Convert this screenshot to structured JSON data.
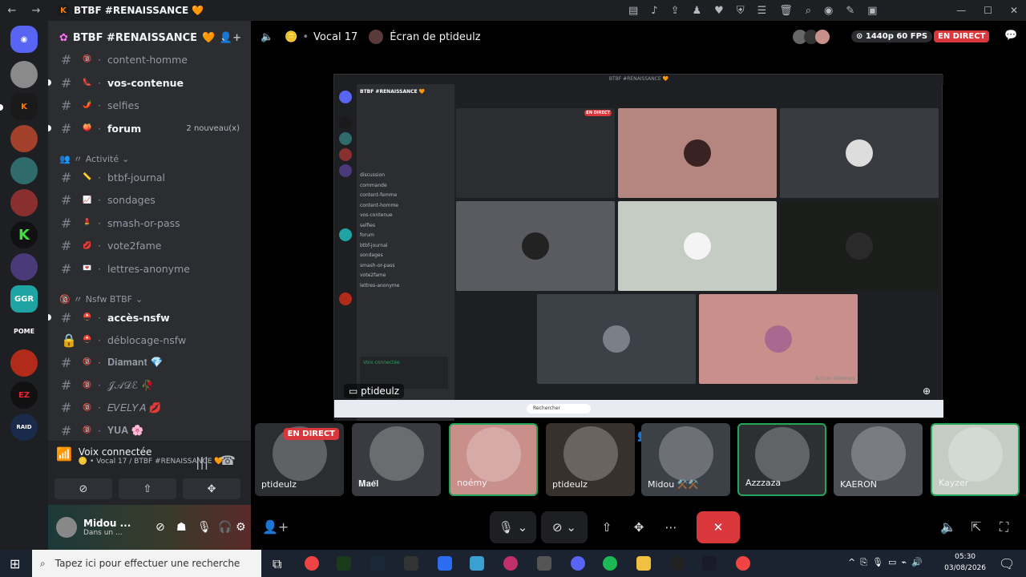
{
  "window": {
    "title": "BTBF #RENAISSANCE 🧡",
    "nav_back": "←",
    "nav_fwd": "→",
    "min": "—",
    "max": "☐",
    "close": "✕"
  },
  "server": {
    "name": "BTBF #RENAISSANCE",
    "heart": "🧡",
    "chevron": "⌄"
  },
  "channels_top": [
    {
      "name": "content-homme",
      "emoji": "🔞",
      "unread": false
    },
    {
      "name": "vos-contenue",
      "emoji": "👠",
      "unread": true
    },
    {
      "name": "selfies",
      "emoji": "🌶️",
      "unread": false
    },
    {
      "name": "forum",
      "emoji": "🍑",
      "unread": true,
      "badge": "2 nouveau(x)"
    }
  ],
  "category_activite": {
    "label": "Activité",
    "prefix": "〃"
  },
  "channels_activite": [
    {
      "name": "btbf-journal",
      "emoji": "📏"
    },
    {
      "name": "sondages",
      "emoji": "📈"
    },
    {
      "name": "smash-or-pass",
      "emoji": "💄"
    },
    {
      "name": "vote2fame",
      "emoji": "💋"
    },
    {
      "name": "lettres-anonyme",
      "emoji": "💌"
    }
  ],
  "category_nsfw": {
    "label": "Nsfw BTBF",
    "prefix": "〃"
  },
  "channels_nsfw": [
    {
      "name": "accès-nsfw",
      "emoji": "⛑️",
      "unread": true,
      "lock": false
    },
    {
      "name": "déblocage-nsfw",
      "emoji": "⛑️",
      "unread": false,
      "lock": true
    },
    {
      "name": "𝐃𝐢𝐚𝐦𝐚𝐧𝐭 💎",
      "emoji": "🔞",
      "unread": false,
      "lock": false
    },
    {
      "name": "𝒥𝒜𝒟ℰ 🥀",
      "emoji": "🔞",
      "unread": false,
      "lock": false
    },
    {
      "name": "𝐸𝑉𝐸𝐿𝑌𝐴 💋",
      "emoji": "🔞",
      "unread": false,
      "lock": false
    },
    {
      "name": "𝐘𝐔𝐀 🌸",
      "emoji": "🔞",
      "unread": false,
      "lock": false
    }
  ],
  "voice": {
    "status": "Voix connectée",
    "sub": "🪙 • Vocal 17 / BTBF #RENAISSANCE 🧡"
  },
  "user": {
    "name": "Midou ...",
    "status": "Dans un ..."
  },
  "stage_header": {
    "channel_emoji": "🪙",
    "channel": "Vocal 17",
    "screen_label": "Écran de ptideulz",
    "quality": "1440p 60 FPS",
    "live": "EN DIRECT"
  },
  "screen": {
    "caption": "ptideulz",
    "mini_title": "BTBF #RENAISSANCE 🧡",
    "mini_server": "BTBF #RENAISSANCE 🧡",
    "mini_channels": [
      "discussion",
      "commande",
      "content-femme",
      "content-homme",
      "vos-contenue",
      "selfies",
      "forum",
      "btbf-journal",
      "sondages",
      "smash-or-pass",
      "vote2fame",
      "lettres-anonyme"
    ],
    "mini_voice": "Voix connectée",
    "mini_live": "EN DIRECT",
    "mini_search": "Rechercher",
    "win_activation": "Activer Windows"
  },
  "participants": [
    {
      "name": "ptideulz",
      "live": "EN DIRECT",
      "color": "#2b2d31"
    },
    {
      "name": "𝐌𝐚𝐞̈𝐥",
      "color": "#3a3b40"
    },
    {
      "name": "noémy",
      "color": "#c98f8a",
      "selected": true
    },
    {
      "name": "ptideulz",
      "color": "#38302c"
    },
    {
      "name": "Midou ⚒️⚒️",
      "color": "#3c4148"
    },
    {
      "name": "Azzzaza",
      "color": "#2d2f33",
      "selected": true
    },
    {
      "name": "KAERON",
      "color": "#4d5056"
    },
    {
      "name": "Kayzer",
      "color": "#c4ccc4",
      "selected": true
    }
  ],
  "taskbar": {
    "search": "Tapez ici pour effectuer une recherche",
    "time": "05:30",
    "date": "03/08/2026"
  },
  "colors": {
    "accent": "#5865f2",
    "live": "#da373c",
    "online": "#23a55a",
    "hangup": "#da373c"
  }
}
